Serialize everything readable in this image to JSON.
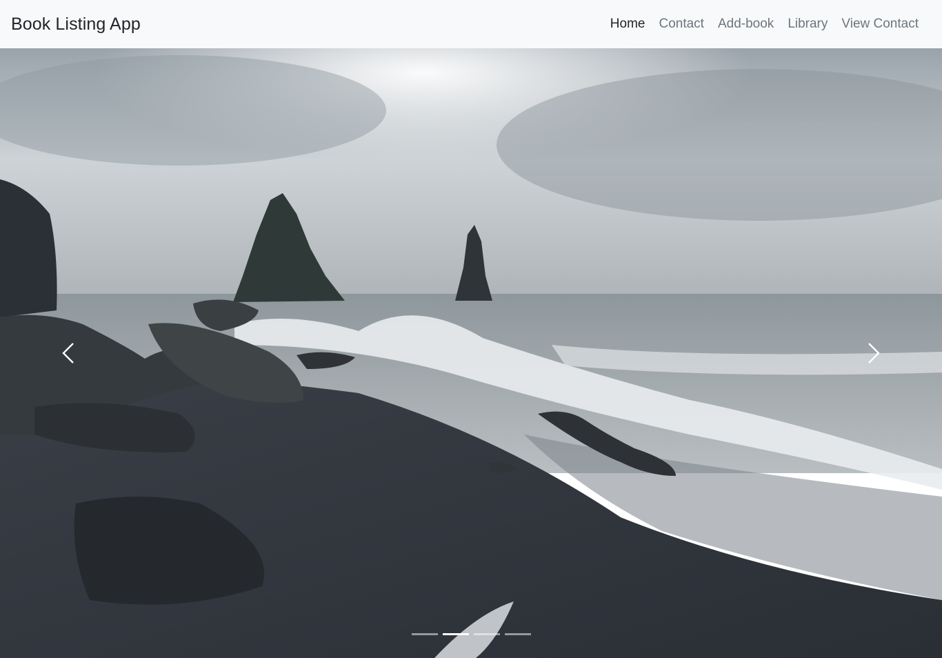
{
  "navbar": {
    "brand": "Book Listing App",
    "links": [
      {
        "label": "Home",
        "active": true
      },
      {
        "label": "Contact",
        "active": false
      },
      {
        "label": "Add-book",
        "active": false
      },
      {
        "label": "Library",
        "active": false
      },
      {
        "label": "View Contact",
        "active": false
      }
    ]
  },
  "carousel": {
    "prev_icon": "chevron-left-icon",
    "next_icon": "chevron-right-icon",
    "slide_count": 4,
    "active_index": 1
  },
  "colors": {
    "navbar_bg": "#f8f9fa",
    "nav_active": "#212529",
    "nav_inactive": "#6c757d"
  }
}
